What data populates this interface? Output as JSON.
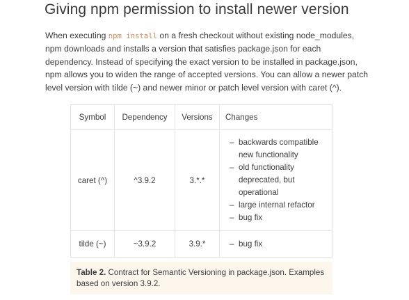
{
  "section": {
    "title": "Giving npm permission to install newer version"
  },
  "intro": {
    "part1": "When executing ",
    "code": "npm install",
    "part2": " on a fresh checkout without existing node_modules, npm downloads and installs a version that satisfies package.json for each dependency. Instead of specifying the exact version to be installed in package.json, npm allows you to widen the range of accepted versions. You can allow a newer patch level version with tilde (~) and newer minor or patch level version with caret (^)."
  },
  "table": {
    "headers": {
      "symbol": "Symbol",
      "dependency": "Dependency",
      "versions": "Versions",
      "changes": "Changes"
    },
    "rows": [
      {
        "symbol": "caret (^)",
        "dependency": "^3.9.2",
        "versions": "3.*.*",
        "changes": [
          "backwards compatible new functionality",
          "old functionality deprecated, but operational",
          "large internal refactor",
          "bug fix"
        ]
      },
      {
        "symbol": "tilde (~)",
        "dependency": "~3.9.2",
        "versions": "3.9.*",
        "changes": [
          "bug fix"
        ]
      }
    ]
  },
  "caption": {
    "label": "Table 2.",
    "text": " Contract for Semantic Versioning in package.json. Examples based on version 3.9.2."
  },
  "colors": {
    "code_text": "#d98755",
    "caption_background": "#fdf6ec",
    "table_border": "#e2e2e2"
  }
}
